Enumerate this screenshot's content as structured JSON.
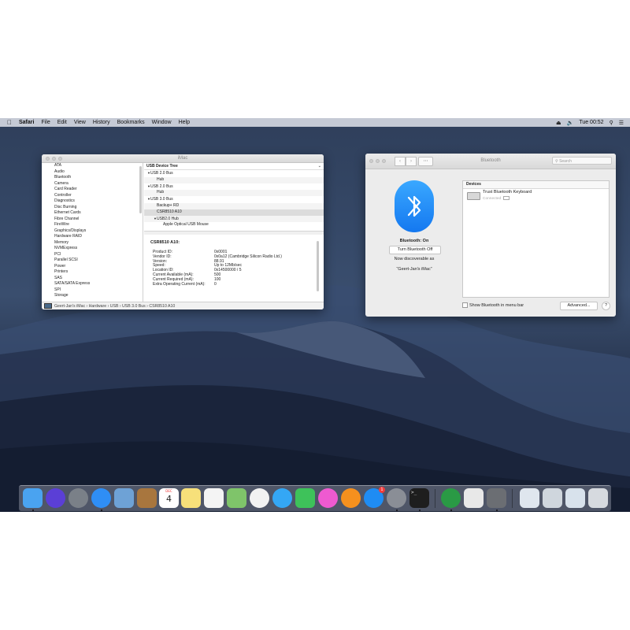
{
  "menubar": {
    "apple": "",
    "app_name": "Safari",
    "items": [
      "File",
      "Edit",
      "View",
      "History",
      "Bookmarks",
      "Window",
      "Help"
    ],
    "clock": "Tue 00:52"
  },
  "sysinfo": {
    "title": "iMac",
    "sidebar": [
      "ATA",
      "Audio",
      "Bluetooth",
      "Camera",
      "Card Reader",
      "Controller",
      "Diagnostics",
      "Disc Burning",
      "Ethernet Cards",
      "Fibre Channel",
      "FireWire",
      "Graphics/Displays",
      "Hardware RAID",
      "Memory",
      "NVMExpress",
      "PCI",
      "Parallel SCSI",
      "Power",
      "Printers",
      "SAS",
      "SATA/SATA Express",
      "SPI",
      "Storage"
    ],
    "tree_header": "USB Device Tree",
    "tree": [
      {
        "label": "USB 2.0 Bus",
        "toggle": "▼",
        "indent": 4
      },
      {
        "label": "Hub",
        "toggle": "",
        "indent": 16
      },
      {
        "label": "USB 2.0 Bus",
        "toggle": "▼",
        "indent": 4
      },
      {
        "label": "Hub",
        "toggle": "",
        "indent": 16
      },
      {
        "label": "USB 3.0 Bus",
        "toggle": "▼",
        "indent": 4
      },
      {
        "label": "Backup+  RD",
        "toggle": "",
        "indent": 16
      },
      {
        "label": "CSR8510 A10",
        "toggle": "",
        "indent": 16
      },
      {
        "label": "USB2.0 Hub",
        "toggle": "▼",
        "indent": 12
      },
      {
        "label": "Apple Optical USB Mouse",
        "toggle": "",
        "indent": 24
      }
    ],
    "detail_title": "CSR8510 A10:",
    "details": [
      {
        "label": "Product ID:",
        "value": "0x0001"
      },
      {
        "label": "Vendor ID:",
        "value": "0x0a12  (Cambridge Silicon Radio Ltd.)"
      },
      {
        "label": "Version:",
        "value": "88.91"
      },
      {
        "label": "Speed:",
        "value": "Up to 12Mb/sec"
      },
      {
        "label": "Location ID:",
        "value": "0x14500000 / 5"
      },
      {
        "label": "Current Available (mA):",
        "value": "500"
      },
      {
        "label": "Current Required (mA):",
        "value": "100"
      },
      {
        "label": "Extra Operating Current (mA):",
        "value": "0"
      }
    ],
    "path": "Geert-Jan's iMac › Hardware › USB › USB 3.0 Bus › CSR8510 A10"
  },
  "bluetooth": {
    "title": "Bluetooth",
    "search_placeholder": "Search",
    "status": "Bluetooth: On",
    "toggle_label": "Turn Bluetooth Off",
    "discoverable_line1": "Now discoverable as",
    "discoverable_line2": "“Geert-Jan's iMac”",
    "devices_header": "Devices",
    "device_name": "Trust Bluetooth Keyboard",
    "device_status": "Connected",
    "show_in_menubar_label": "Show Bluetooth in menu bar",
    "advanced_label": "Advanced...",
    "help_label": "?"
  },
  "dock": {
    "calendar_month": "DEC",
    "calendar_day": "4",
    "appstore_badge": "1",
    "icons": [
      {
        "name": "finder-icon",
        "color": "#4aa3f0",
        "running": true
      },
      {
        "name": "siri-icon",
        "color": "#5b3fd6",
        "running": false
      },
      {
        "name": "launchpad-icon",
        "color": "#7a8088",
        "running": false
      },
      {
        "name": "safari-icon",
        "color": "#2f8ef5",
        "running": true
      },
      {
        "name": "preview-icon",
        "color": "#6ea2d6",
        "running": false
      },
      {
        "name": "contacts-icon",
        "color": "#a8763e",
        "running": false
      },
      {
        "name": "calendar-icon",
        "color": "#ffffff",
        "running": false
      },
      {
        "name": "notes-icon",
        "color": "#f7e07a",
        "running": false
      },
      {
        "name": "reminders-icon",
        "color": "#f4f4f4",
        "running": false
      },
      {
        "name": "maps-icon",
        "color": "#7fc46a",
        "running": false
      },
      {
        "name": "photos-icon",
        "color": "#f2f2f2",
        "running": false
      },
      {
        "name": "messages-icon",
        "color": "#34a7f5",
        "running": false
      },
      {
        "name": "facetime-icon",
        "color": "#3ec25a",
        "running": false
      },
      {
        "name": "itunes-icon",
        "color": "#ee5ad0",
        "running": false
      },
      {
        "name": "ibooks-icon",
        "color": "#f5901e",
        "running": false
      },
      {
        "name": "appstore-icon",
        "color": "#1f8cf3",
        "running": false
      },
      {
        "name": "system-preferences-icon",
        "color": "#8a8e96",
        "running": true
      },
      {
        "name": "terminal-icon",
        "color": "#1e1e1e",
        "running": true
      },
      {
        "name": "disk-utility-icon",
        "color": "#2a9a45",
        "running": true
      },
      {
        "name": "textedit-icon",
        "color": "#e8e8e8",
        "running": false
      },
      {
        "name": "usb-tool-icon",
        "color": "#6b6e73",
        "running": true
      },
      {
        "name": "document-folder-icon",
        "color": "#dfe6ee",
        "running": false
      },
      {
        "name": "system-report-folder-icon",
        "color": "#cfd6dd",
        "running": false
      },
      {
        "name": "downloads-folder-icon",
        "color": "#d8e2ec",
        "running": false
      },
      {
        "name": "trash-icon",
        "color": "#d6dadf",
        "running": false
      }
    ]
  }
}
